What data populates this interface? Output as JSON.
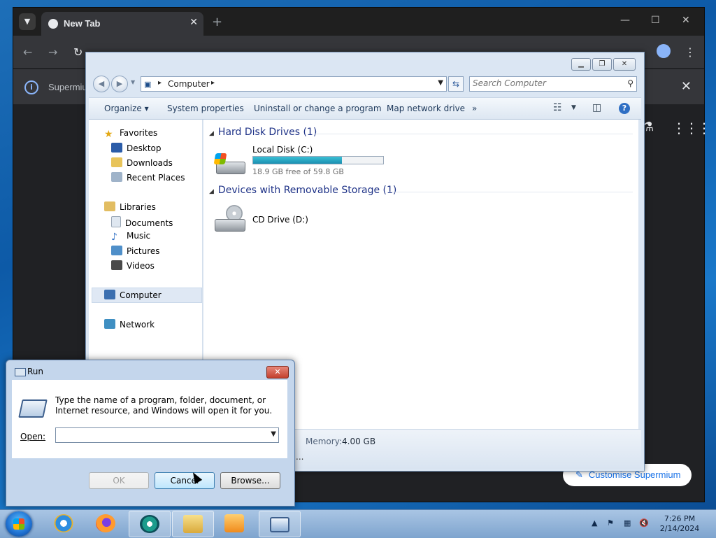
{
  "browser": {
    "tab_title": "New Tab",
    "tab_close": "✕",
    "new_tab": "+",
    "infobar_text": "Supermium",
    "customise_label": "Customise Supermium"
  },
  "explorer": {
    "address": "Computer",
    "search_placeholder": "Search Computer",
    "commands": {
      "organize": "Organize ▾",
      "system_properties": "System properties",
      "uninstall": "Uninstall or change a program",
      "map_drive": "Map network drive",
      "more": "»"
    },
    "nav": {
      "favorites": "Favorites",
      "desktop": "Desktop",
      "downloads": "Downloads",
      "recent": "Recent Places",
      "libraries": "Libraries",
      "documents": "Documents",
      "music": "Music",
      "pictures": "Pictures",
      "videos": "Videos",
      "computer": "Computer",
      "network": "Network"
    },
    "groups": {
      "hdd": "Hard Disk Drives (1)",
      "removable": "Devices with Removable Storage (1)"
    },
    "drives": {
      "c_name": "Local Disk (C:)",
      "c_free": "18.9 GB free of 59.8 GB",
      "c_used_fraction": 0.684,
      "d_name": "CD Drive (D:)"
    },
    "details": {
      "memory_label": "Memory:",
      "memory_value": "4.00 GB",
      "ellipsis": "..."
    }
  },
  "run": {
    "title": "Run",
    "message": "Type the name of a program, folder, document, or Internet resource, and Windows will open it for you.",
    "open_label": "Open:",
    "open_value": "",
    "ok": "OK",
    "cancel": "Cancel",
    "browse": "Browse..."
  },
  "taskbar": {
    "time": "7:26 PM",
    "date": "2/14/2024"
  }
}
